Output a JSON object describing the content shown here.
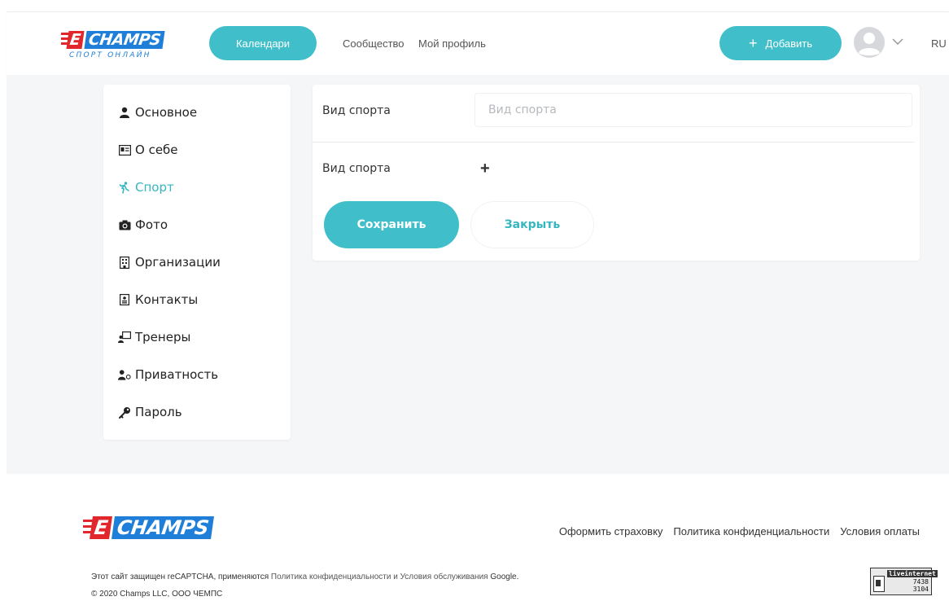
{
  "header": {
    "logo": {
      "brand_e": "E",
      "brand_name": "CHAMPS",
      "tagline": "СПОРТ ОНЛАЙН"
    },
    "calendar_label": "Календари",
    "nav": [
      {
        "label": "Сообщество"
      },
      {
        "label": "Мой профиль"
      }
    ],
    "add_label": "Добавить",
    "lang": "RU"
  },
  "sidebar": {
    "items": [
      {
        "label": "Основное",
        "icon": "user-icon"
      },
      {
        "label": "О себе",
        "icon": "id-card-icon"
      },
      {
        "label": "Спорт",
        "icon": "running-icon",
        "active": true
      },
      {
        "label": "Фото",
        "icon": "camera-icon"
      },
      {
        "label": "Организации",
        "icon": "building-icon"
      },
      {
        "label": "Контакты",
        "icon": "contact-icon"
      },
      {
        "label": "Тренеры",
        "icon": "trainer-icon"
      },
      {
        "label": "Приватность",
        "icon": "privacy-icon"
      },
      {
        "label": "Пароль",
        "icon": "key-icon"
      }
    ]
  },
  "form": {
    "sport_label": "Вид спорта",
    "sport_value": "",
    "sport_placeholder": "Вид спорта",
    "add_sport_label": "Вид спорта",
    "add_sport_symbol": "+",
    "save_label": "Сохранить",
    "close_label": "Закрыть"
  },
  "footer": {
    "logo": {
      "brand_e": "E",
      "brand_name": "CHAMPS"
    },
    "links": [
      "Оформить страховку",
      "Политика конфиденциальности",
      "Условия оплаты"
    ],
    "recaptcha_prefix": "Этот сайт защищен reCAPTCHA, применяются",
    "recaptcha_link1": "Политика конфиденциальности",
    "recaptcha_and": "и",
    "recaptcha_link2": "Условия обслуживания",
    "recaptcha_google": "Google.",
    "copyright": "© 2020 Champs LLC, ООО ЧЕМПС",
    "counter": {
      "title": "liveinternet",
      "n1": "7438",
      "n2": "3104"
    }
  },
  "colors": {
    "accent": "#40bfca",
    "brand_blue": "#1f7fd8",
    "brand_red": "#e1262c",
    "bg": "#f5f6f8"
  }
}
